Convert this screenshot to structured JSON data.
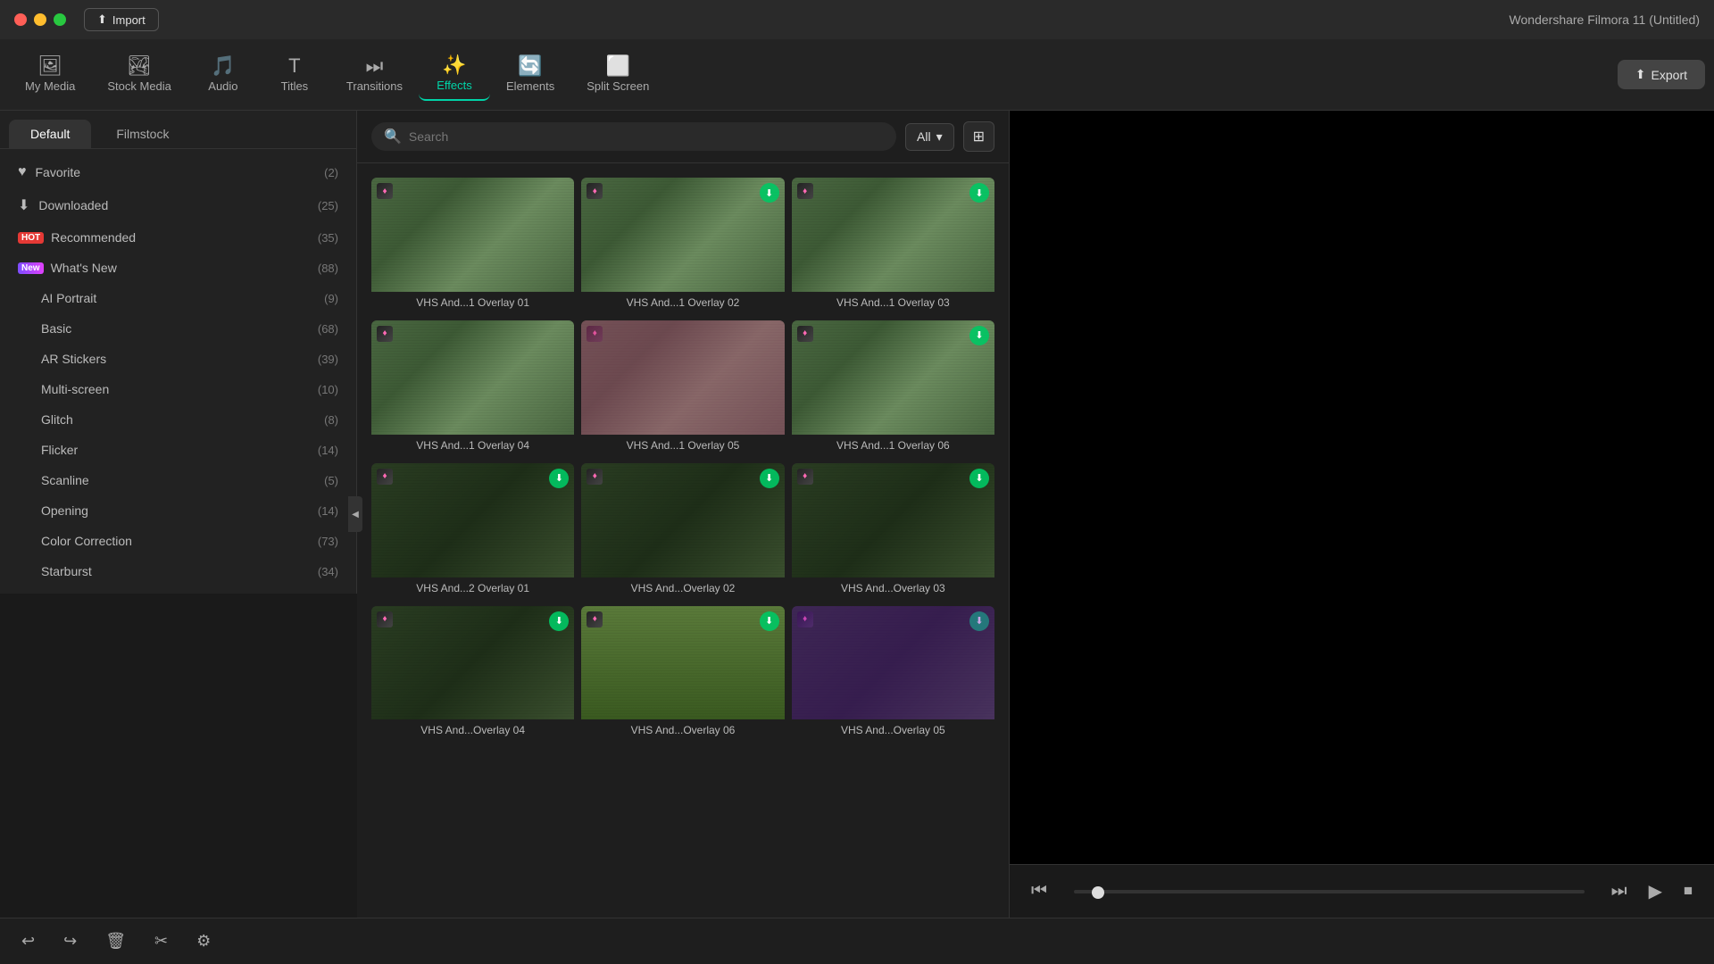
{
  "titleBar": {
    "importLabel": "Import",
    "appTitle": "Wondershare Filmora 11 (Untitled)"
  },
  "topNav": {
    "items": [
      {
        "id": "my-media",
        "label": "My Media",
        "icon": "🖼"
      },
      {
        "id": "stock-media",
        "label": "Stock Media",
        "icon": "🏞"
      },
      {
        "id": "audio",
        "label": "Audio",
        "icon": "🎵"
      },
      {
        "id": "titles",
        "label": "Titles",
        "icon": "T"
      },
      {
        "id": "transitions",
        "label": "Transitions",
        "icon": "⏭"
      },
      {
        "id": "effects",
        "label": "Effects",
        "icon": "✨",
        "active": true
      },
      {
        "id": "elements",
        "label": "Elements",
        "icon": "🔄"
      },
      {
        "id": "split-screen",
        "label": "Split Screen",
        "icon": "⬜"
      }
    ],
    "exportLabel": "Export"
  },
  "leftPanel": {
    "tabs": [
      {
        "id": "default",
        "label": "Default",
        "active": true
      },
      {
        "id": "filmstock",
        "label": "Filmstock",
        "active": false
      }
    ],
    "categories": [
      {
        "id": "favorite",
        "icon": "♥",
        "label": "Favorite",
        "count": 2,
        "badge": null
      },
      {
        "id": "downloaded",
        "icon": "⬇",
        "label": "Downloaded",
        "count": 25,
        "badge": null
      },
      {
        "id": "recommended",
        "icon": null,
        "label": "Recommended",
        "count": 35,
        "badge": "HOT"
      },
      {
        "id": "whats-new",
        "icon": null,
        "label": "What's New",
        "count": 88,
        "badge": "New"
      },
      {
        "id": "ai-portrait",
        "icon": null,
        "label": "AI Portrait",
        "count": 9,
        "badge": null
      },
      {
        "id": "basic",
        "icon": null,
        "label": "Basic",
        "count": 68,
        "badge": null
      },
      {
        "id": "ar-stickers",
        "icon": null,
        "label": "AR Stickers",
        "count": 39,
        "badge": null
      },
      {
        "id": "multi-screen",
        "icon": null,
        "label": "Multi-screen",
        "count": 10,
        "badge": null
      },
      {
        "id": "glitch",
        "icon": null,
        "label": "Glitch",
        "count": 8,
        "badge": null
      },
      {
        "id": "flicker",
        "icon": null,
        "label": "Flicker",
        "count": 14,
        "badge": null
      },
      {
        "id": "scanline",
        "icon": null,
        "label": "Scanline",
        "count": 5,
        "badge": null
      },
      {
        "id": "opening",
        "icon": null,
        "label": "Opening",
        "count": 14,
        "badge": null
      },
      {
        "id": "color-correction",
        "icon": null,
        "label": "Color Correction",
        "count": 73,
        "badge": null
      },
      {
        "id": "starburst",
        "icon": null,
        "label": "Starburst",
        "count": 34,
        "badge": null
      }
    ]
  },
  "searchBar": {
    "placeholder": "Search",
    "filterLabel": "All",
    "gridIcon": "⊞"
  },
  "effectsGrid": {
    "items": [
      {
        "id": "vhs-1-01",
        "label": "VHS And...1 Overlay 01",
        "style": "normal",
        "hasDiamond": true,
        "hasDownload": false
      },
      {
        "id": "vhs-1-02",
        "label": "VHS And...1 Overlay 02",
        "style": "normal",
        "hasDiamond": true,
        "hasDownload": true
      },
      {
        "id": "vhs-1-03",
        "label": "VHS And...1 Overlay 03",
        "style": "normal",
        "hasDiamond": true,
        "hasDownload": true
      },
      {
        "id": "vhs-1-04",
        "label": "VHS And...1 Overlay 04",
        "style": "normal",
        "hasDiamond": true,
        "hasDownload": false
      },
      {
        "id": "vhs-1-05",
        "label": "VHS And...1 Overlay 05",
        "style": "pink",
        "hasDiamond": true,
        "hasDownload": false
      },
      {
        "id": "vhs-1-06",
        "label": "VHS And...1 Overlay 06",
        "style": "normal",
        "hasDiamond": true,
        "hasDownload": true
      },
      {
        "id": "vhs-2-01",
        "label": "VHS And...2 Overlay 01",
        "style": "dark",
        "hasDiamond": true,
        "hasDownload": true
      },
      {
        "id": "vhs-2-02",
        "label": "VHS And...Overlay 02",
        "style": "dark",
        "hasDiamond": true,
        "hasDownload": true
      },
      {
        "id": "vhs-2-03",
        "label": "VHS And...Overlay 03",
        "style": "dark",
        "hasDiamond": true,
        "hasDownload": true
      },
      {
        "id": "vhs-3-04",
        "label": "VHS And...Overlay 04",
        "style": "dark",
        "hasDiamond": true,
        "hasDownload": true
      },
      {
        "id": "vhs-3-06",
        "label": "VHS And...Overlay 06",
        "style": "aerial",
        "hasDiamond": true,
        "hasDownload": true
      },
      {
        "id": "vhs-3-05",
        "label": "VHS And...Overlay 05",
        "style": "purple",
        "hasDiamond": true,
        "hasDownload": true
      }
    ]
  },
  "bottomToolbar": {
    "buttons": [
      {
        "id": "back",
        "icon": "↩"
      },
      {
        "id": "forward",
        "icon": "↪"
      },
      {
        "id": "delete",
        "icon": "🗑"
      },
      {
        "id": "cut",
        "icon": "✂"
      },
      {
        "id": "settings",
        "icon": "⚙"
      }
    ]
  },
  "previewControls": {
    "rewindIcon": "⏮",
    "playPauseIcon": "▶▶",
    "playIcon": "▶",
    "stopIcon": "⏹",
    "progressPercent": 3
  }
}
